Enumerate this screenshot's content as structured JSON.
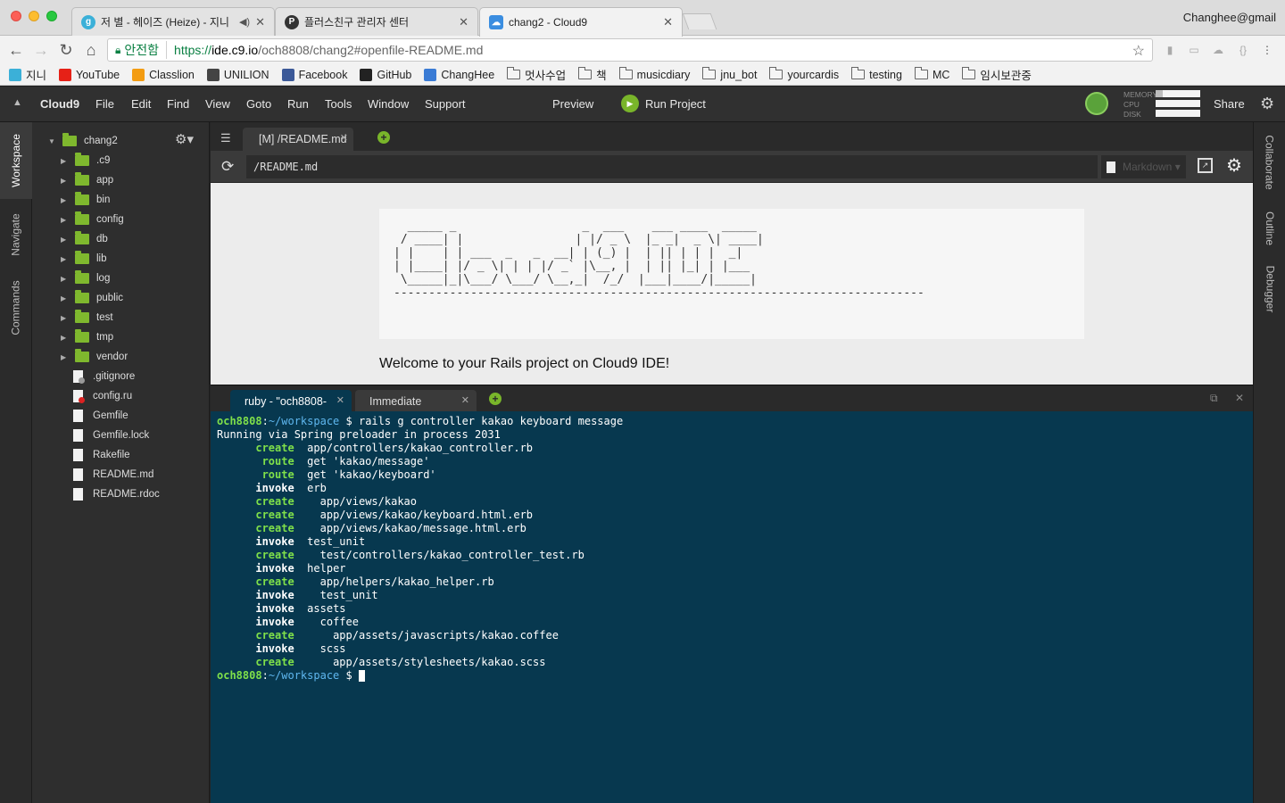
{
  "browser": {
    "tabs": [
      {
        "title": "저 별 - 헤이즈 (Heize) - 지니",
        "favicon": "genie-icon",
        "audio": true
      },
      {
        "title": "플러스친구 관리자 센터",
        "favicon": "plusfriend-icon",
        "audio": false
      },
      {
        "title": "chang2 - Cloud9",
        "favicon": "cloud9-icon",
        "audio": false
      }
    ],
    "profile_name": "Changhee@gmail",
    "url": {
      "secure_label": "안전함",
      "scheme": "https://",
      "host": "ide.c9.io",
      "path": "/och8808/chang2#openfile-README.md"
    },
    "bookmarks": [
      {
        "label": "지니",
        "icon": "genie-icon",
        "color": "#3bb0d8"
      },
      {
        "label": "YouTube",
        "icon": "youtube-icon",
        "color": "#e62117"
      },
      {
        "label": "Classlion",
        "icon": "classlion-icon",
        "color": "#f39c12"
      },
      {
        "label": "UNILION",
        "icon": "unilion-icon",
        "color": "#444444"
      },
      {
        "label": "Facebook",
        "icon": "facebook-icon",
        "color": "#3b5998"
      },
      {
        "label": "GitHub",
        "icon": "github-icon",
        "color": "#222222"
      },
      {
        "label": "ChangHee",
        "icon": "changhee-icon",
        "color": "#3a7bd5"
      },
      {
        "label": "멋사수업",
        "icon": "folder-icon"
      },
      {
        "label": "책",
        "icon": "folder-icon"
      },
      {
        "label": "musicdiary",
        "icon": "folder-icon"
      },
      {
        "label": "jnu_bot",
        "icon": "folder-icon"
      },
      {
        "label": "yourcardis",
        "icon": "folder-icon"
      },
      {
        "label": "testing",
        "icon": "folder-icon"
      },
      {
        "label": "MC",
        "icon": "folder-icon"
      },
      {
        "label": "임시보관중",
        "icon": "folder-icon"
      }
    ]
  },
  "ide": {
    "brand": "Cloud9",
    "menu": [
      "File",
      "Edit",
      "Find",
      "View",
      "Goto",
      "Run",
      "Tools",
      "Window",
      "Support"
    ],
    "preview_label": "Preview",
    "run_label": "Run Project",
    "stats": {
      "memory": "MEMORY",
      "cpu": "CPU",
      "disk": "DISK"
    },
    "share_label": "Share",
    "left_panels": [
      "Workspace",
      "Navigate",
      "Commands"
    ],
    "right_panels": [
      "Collaborate",
      "Outline",
      "Debugger"
    ],
    "accent": "#79b52a",
    "tree": {
      "root": "chang2",
      "folders": [
        ".c9",
        "app",
        "bin",
        "config",
        "db",
        "lib",
        "log",
        "public",
        "test",
        "tmp",
        "vendor"
      ],
      "files": [
        ".gitignore",
        "config.ru",
        "Gemfile",
        "Gemfile.lock",
        "Rakefile",
        "README.md",
        "README.rdoc"
      ]
    },
    "editor": {
      "tab_label": "[M] /README.md",
      "preview_path": "/README.md",
      "mode_label": "Markdown",
      "banner_ascii": "  _____ _                  _  ___    ___ ____  _____ \n / ____| |                | |/ _ \\  |_ _|  _ \\| ____|\n| |    | | ___  _   _  __| | (_) |  | || | | |  _|  \n| |____| |/ _ \\| | | |/ _` |\\__, |  | || |_| | |___ \n \\_____|_|\\___/ \\___/ \\__,_|  /_/  |___|____/|_____|\n----------------------------------------------------------------------------",
      "welcome_text": "Welcome to your Rails project on Cloud9 IDE!"
    },
    "terminal": {
      "tabs": [
        "ruby - \"och8808-",
        "Immediate"
      ],
      "prompt_host": "och8808",
      "prompt_dir": "~/workspace",
      "command": "rails g controller kakao keyboard message",
      "running_line": "Running via Spring preloader in process 2031",
      "lines": [
        {
          "indent": "      ",
          "kw": "create",
          "text": "  app/controllers/kakao_controller.rb"
        },
        {
          "indent": "       ",
          "kw": "route",
          "text": "  get 'kakao/message'"
        },
        {
          "indent": "       ",
          "kw": "route",
          "text": "  get 'kakao/keyboard'"
        },
        {
          "indent": "      ",
          "kw": "invoke",
          "text": "  erb",
          "white": true
        },
        {
          "indent": "      ",
          "kw": "create",
          "text": "    app/views/kakao"
        },
        {
          "indent": "      ",
          "kw": "create",
          "text": "    app/views/kakao/keyboard.html.erb"
        },
        {
          "indent": "      ",
          "kw": "create",
          "text": "    app/views/kakao/message.html.erb"
        },
        {
          "indent": "      ",
          "kw": "invoke",
          "text": "  test_unit",
          "white": true
        },
        {
          "indent": "      ",
          "kw": "create",
          "text": "    test/controllers/kakao_controller_test.rb"
        },
        {
          "indent": "      ",
          "kw": "invoke",
          "text": "  helper",
          "white": true
        },
        {
          "indent": "      ",
          "kw": "create",
          "text": "    app/helpers/kakao_helper.rb"
        },
        {
          "indent": "      ",
          "kw": "invoke",
          "text": "    test_unit",
          "white": true
        },
        {
          "indent": "      ",
          "kw": "invoke",
          "text": "  assets",
          "white": true
        },
        {
          "indent": "      ",
          "kw": "invoke",
          "text": "    coffee",
          "white": true
        },
        {
          "indent": "      ",
          "kw": "create",
          "text": "      app/assets/javascripts/kakao.coffee"
        },
        {
          "indent": "      ",
          "kw": "invoke",
          "text": "    scss",
          "white": true
        },
        {
          "indent": "      ",
          "kw": "create",
          "text": "      app/assets/stylesheets/kakao.scss"
        }
      ],
      "final_prompt": "$"
    }
  }
}
